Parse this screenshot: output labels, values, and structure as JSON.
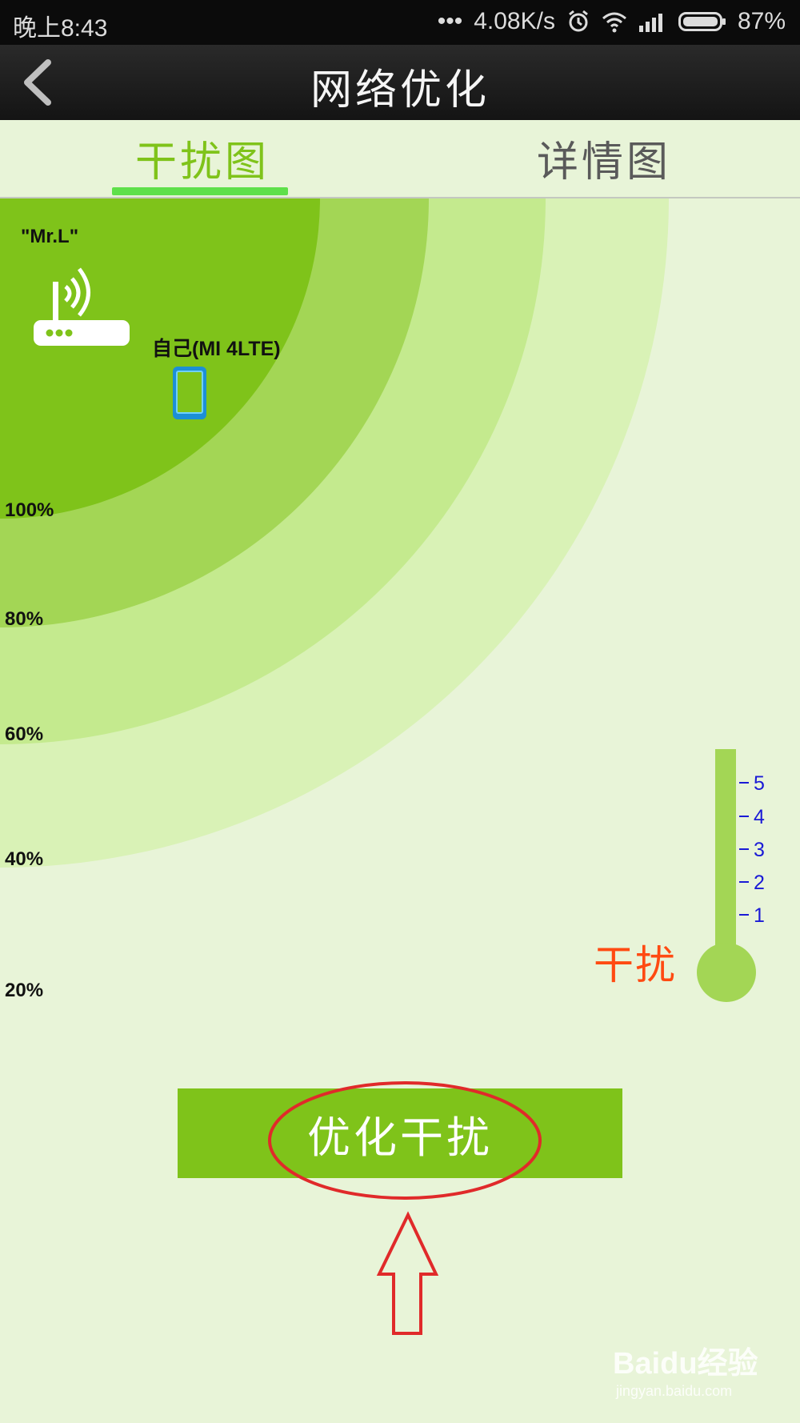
{
  "status_bar": {
    "time": "晚上8:43",
    "dots": "•••",
    "net_speed": "4.08K/s",
    "battery": "87%",
    "icons": [
      "alarm-icon",
      "wifi-icon",
      "signal-icon",
      "battery-icon"
    ]
  },
  "header": {
    "title": "网络优化",
    "back_icon": "chevron-left-icon"
  },
  "tabs": [
    {
      "label": "干扰图",
      "active": true
    },
    {
      "label": "详情图",
      "active": false
    }
  ],
  "radar": {
    "ap_name": "\"Mr.L\"",
    "self_device": "自己(MI 4LTE)",
    "levels": [
      "100%",
      "80%",
      "60%",
      "40%",
      "20%"
    ],
    "colors": [
      "#7fc31a",
      "#a3d655",
      "#c4ea8e",
      "#d9f2b6",
      "#e8f4d8"
    ]
  },
  "thermometer": {
    "label": "干扰",
    "scale": [
      "5",
      "4",
      "3",
      "2",
      "1"
    ],
    "color": "#a3d655"
  },
  "optimize_button": {
    "label": "优化干扰"
  },
  "watermark": {
    "text": "Baidu经验",
    "sub": "jingyan.baidu.com"
  }
}
